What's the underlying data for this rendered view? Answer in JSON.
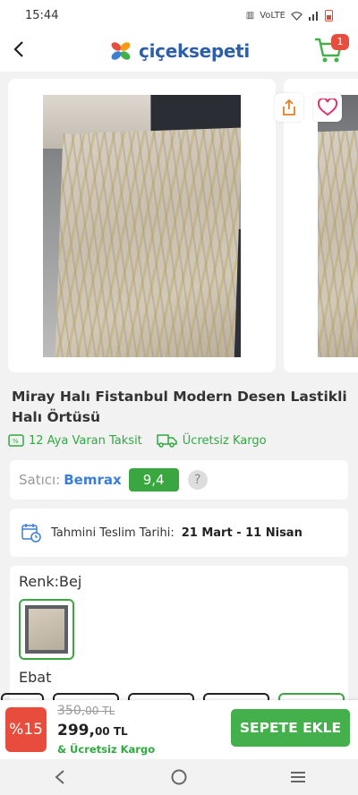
{
  "statusbar": {
    "time": "15:44",
    "net_label": "VoLTE"
  },
  "header": {
    "logo_text": "çiçeksepeti",
    "cart_count": "1"
  },
  "product": {
    "title": "Miray Halı Fistanbul Modern Desen Lastikli Halı Örtüsü",
    "perks": {
      "installment": "12 Aya Varan Taksit",
      "shipping": "Ücretsiz Kargo"
    }
  },
  "seller": {
    "label": "Satıcı:",
    "name": "Bemrax",
    "score": "9,4",
    "help": "?"
  },
  "delivery": {
    "label": "Tahmini Teslim Tarihi:",
    "date": "21 Mart - 11 Nisan"
  },
  "options": {
    "color_label": "Renk:Bej",
    "size_label": "Ebat"
  },
  "purchase": {
    "discount": "%15",
    "old_price_main": "350,",
    "old_price_tail": "00 TL",
    "new_price_main": "299,",
    "new_price_tail": "00 TL",
    "free_shipping": "& Ücretsiz Kargo",
    "add_to_cart": "SEPETE EKLE"
  },
  "colors": {
    "brand_green": "#44b04b",
    "discount_red": "#e74c3c",
    "seller_blue": "#3b7ed6"
  }
}
